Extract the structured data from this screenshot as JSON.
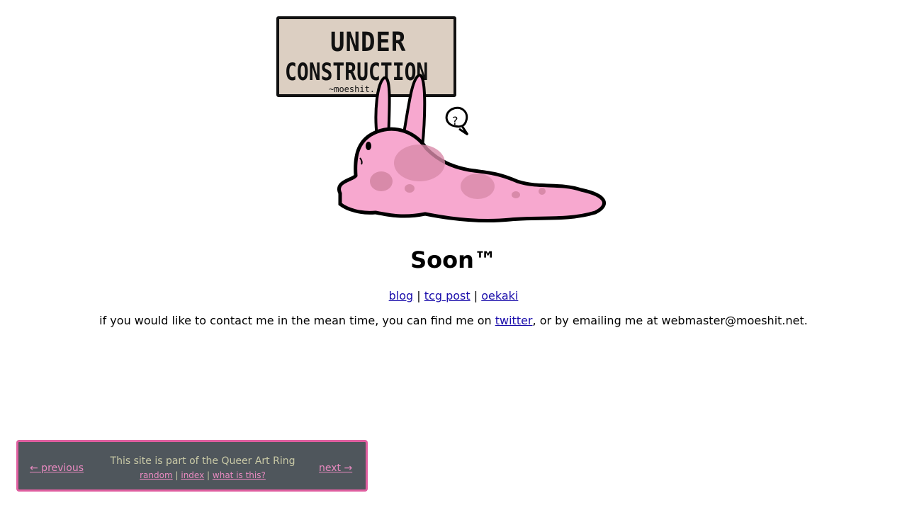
{
  "hero": {
    "sign_line1": "UNDER",
    "sign_line2": "CONSTRUCTION",
    "sign_credit": "~moeshit.",
    "bunny_thought": "?"
  },
  "heading": "Soon™",
  "nav": {
    "items": [
      {
        "label": "blog"
      },
      {
        "label": "tcg post"
      },
      {
        "label": "oekaki"
      }
    ],
    "separator": "|"
  },
  "contact": {
    "before": "if you would like to contact me in the mean time, you can find me on ",
    "link": "twitter",
    "after": ", or by emailing me at webmaster@moeshit.net."
  },
  "webring": {
    "title": "This site is part of the Queer Art Ring",
    "previous": "← previous",
    "next": "next →",
    "links": [
      "random",
      "index",
      "what is this?"
    ],
    "separator": "|",
    "colors": {
      "background": "#4f565c",
      "border": "#e05fa0",
      "link": "#e88ac0"
    }
  }
}
